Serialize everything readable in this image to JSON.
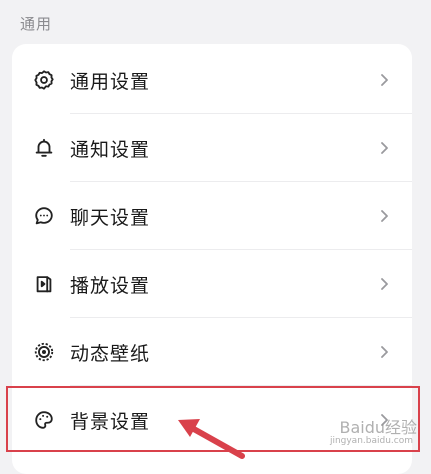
{
  "section": {
    "title": "通用"
  },
  "menu": {
    "items": [
      {
        "label": "通用设置",
        "icon": "gear-icon"
      },
      {
        "label": "通知设置",
        "icon": "bell-icon"
      },
      {
        "label": "聊天设置",
        "icon": "chat-bubble-icon"
      },
      {
        "label": "播放设置",
        "icon": "playback-icon"
      },
      {
        "label": "动态壁纸",
        "icon": "live-wallpaper-icon"
      },
      {
        "label": "背景设置",
        "icon": "palette-icon"
      }
    ]
  },
  "annotation": {
    "highlight_color": "#d9414b",
    "highlighted_item": "背景设置"
  },
  "watermark": {
    "text": "Baidu经验",
    "subtext": "jingyan.baidu.com"
  }
}
